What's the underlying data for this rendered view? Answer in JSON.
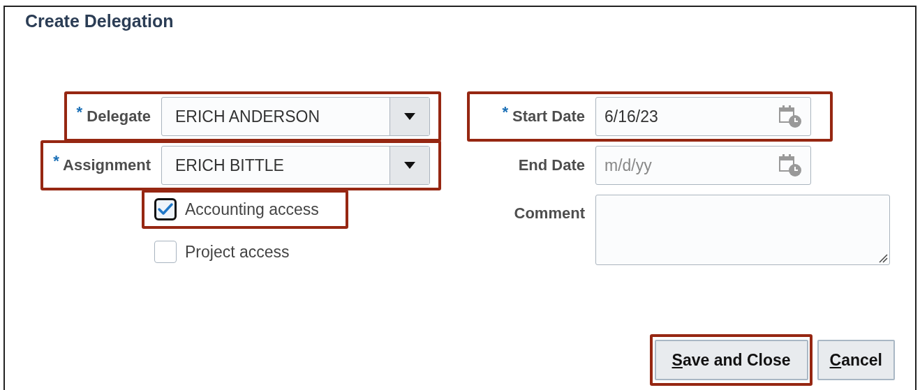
{
  "title": "Create Delegation",
  "left_fields": [
    {
      "label": "Delegate",
      "marker": "*",
      "kind": "select",
      "value": "ERICH ANDERSON",
      "highlighted": true
    },
    {
      "label": "Assignment",
      "marker": "*",
      "kind": "select",
      "value": "ERICH BITTLE",
      "highlighted": true
    }
  ],
  "options": [
    {
      "label": "Accounting access",
      "checked": true,
      "highlighted": true
    },
    {
      "label": "Project access",
      "checked": false,
      "highlighted": false
    }
  ],
  "right_fields": [
    {
      "label": "Start Date",
      "marker": "*",
      "kind": "date",
      "value": "6/16/23",
      "highlighted": true
    },
    {
      "label": "End Date",
      "kind": "date",
      "placeholder": "m/d/yy",
      "highlighted": false
    },
    {
      "label": "Comment",
      "kind": "textarea",
      "highlighted": false
    }
  ],
  "buttons": [
    {
      "label": "Save and Close",
      "underline_first": true,
      "highlighted": true
    },
    {
      "label": "Cancel",
      "underline_first": true,
      "highlighted": false
    }
  ]
}
